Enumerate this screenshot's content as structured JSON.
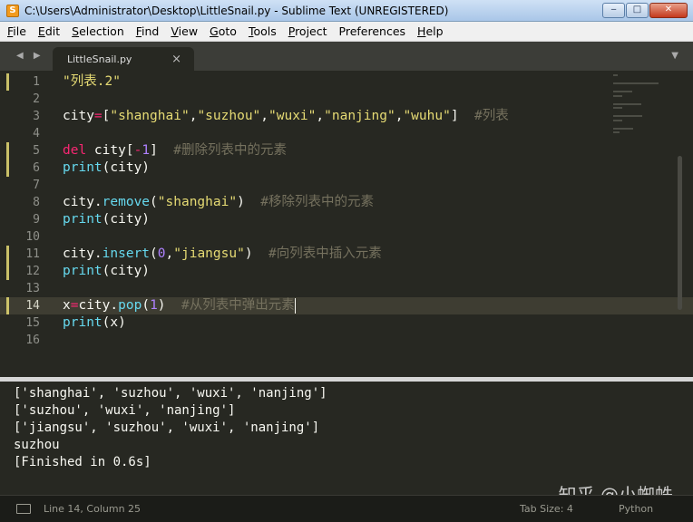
{
  "window": {
    "title": "C:\\Users\\Administrator\\Desktop\\LittleSnail.py - Sublime Text (UNREGISTERED)",
    "app_icon": "S",
    "minimize": "‒",
    "maximize": "□",
    "close": "✕"
  },
  "menu": {
    "items": [
      {
        "first": "F",
        "rest": "ile"
      },
      {
        "first": "E",
        "rest": "dit"
      },
      {
        "first": "S",
        "rest": "election"
      },
      {
        "first": "F",
        "rest": "ind"
      },
      {
        "first": "V",
        "rest": "iew"
      },
      {
        "first": "G",
        "rest": "oto"
      },
      {
        "first": "T",
        "rest": "ools"
      },
      {
        "first": "P",
        "rest": "roject"
      },
      {
        "first": "",
        "rest": "Preferences"
      },
      {
        "first": "H",
        "rest": "elp"
      }
    ]
  },
  "tabs": {
    "nav": "◀ ▶",
    "active": {
      "label": "LittleSnail.py",
      "close": "×"
    },
    "dropdown": "▼"
  },
  "editor": {
    "active_line": 14,
    "lines": [
      {
        "num": "1",
        "tokens": [
          {
            "t": "\"列表.2\"",
            "c": "s"
          }
        ]
      },
      {
        "num": "2",
        "tokens": []
      },
      {
        "num": "3",
        "tokens": [
          {
            "t": "city",
            "c": ""
          },
          {
            "t": "=",
            "c": "k"
          },
          {
            "t": "[",
            "c": ""
          },
          {
            "t": "\"shanghai\"",
            "c": "s"
          },
          {
            "t": ",",
            "c": ""
          },
          {
            "t": "\"suzhou\"",
            "c": "s"
          },
          {
            "t": ",",
            "c": ""
          },
          {
            "t": "\"wuxi\"",
            "c": "s"
          },
          {
            "t": ",",
            "c": ""
          },
          {
            "t": "\"nanjing\"",
            "c": "s"
          },
          {
            "t": ",",
            "c": ""
          },
          {
            "t": "\"wuhu\"",
            "c": "s"
          },
          {
            "t": "]  ",
            "c": ""
          },
          {
            "t": "#列表",
            "c": "c"
          }
        ]
      },
      {
        "num": "4",
        "tokens": []
      },
      {
        "num": "5",
        "tokens": [
          {
            "t": "del",
            "c": "k"
          },
          {
            "t": " city[",
            "c": ""
          },
          {
            "t": "-",
            "c": "k"
          },
          {
            "t": "1",
            "c": "n"
          },
          {
            "t": "]  ",
            "c": ""
          },
          {
            "t": "#删除列表中的元素",
            "c": "c"
          }
        ]
      },
      {
        "num": "6",
        "tokens": [
          {
            "t": "print",
            "c": "f"
          },
          {
            "t": "(city)",
            "c": ""
          }
        ]
      },
      {
        "num": "7",
        "tokens": []
      },
      {
        "num": "8",
        "tokens": [
          {
            "t": "city.",
            "c": ""
          },
          {
            "t": "remove",
            "c": "f"
          },
          {
            "t": "(",
            "c": ""
          },
          {
            "t": "\"shanghai\"",
            "c": "s"
          },
          {
            "t": ")  ",
            "c": ""
          },
          {
            "t": "#移除列表中的元素",
            "c": "c"
          }
        ]
      },
      {
        "num": "9",
        "tokens": [
          {
            "t": "print",
            "c": "f"
          },
          {
            "t": "(city)",
            "c": ""
          }
        ]
      },
      {
        "num": "10",
        "tokens": []
      },
      {
        "num": "11",
        "tokens": [
          {
            "t": "city.",
            "c": ""
          },
          {
            "t": "insert",
            "c": "f"
          },
          {
            "t": "(",
            "c": ""
          },
          {
            "t": "0",
            "c": "n"
          },
          {
            "t": ",",
            "c": ""
          },
          {
            "t": "\"jiangsu\"",
            "c": "s"
          },
          {
            "t": ")  ",
            "c": ""
          },
          {
            "t": "#向列表中插入元素",
            "c": "c"
          }
        ]
      },
      {
        "num": "12",
        "tokens": [
          {
            "t": "print",
            "c": "f"
          },
          {
            "t": "(city)",
            "c": ""
          }
        ]
      },
      {
        "num": "13",
        "tokens": []
      },
      {
        "num": "14",
        "tokens": [
          {
            "t": "x",
            "c": ""
          },
          {
            "t": "=",
            "c": "k"
          },
          {
            "t": "city.",
            "c": ""
          },
          {
            "t": "pop",
            "c": "f"
          },
          {
            "t": "(",
            "c": ""
          },
          {
            "t": "1",
            "c": "n"
          },
          {
            "t": ")  ",
            "c": ""
          },
          {
            "t": "#从列表中弹出元素",
            "c": "c"
          }
        ],
        "cursor": true
      },
      {
        "num": "15",
        "tokens": [
          {
            "t": "print",
            "c": "f"
          },
          {
            "t": "(x)",
            "c": ""
          }
        ]
      },
      {
        "num": "16",
        "tokens": []
      }
    ],
    "modified_lines": [
      "1",
      "5",
      "6",
      "11",
      "12",
      "14"
    ]
  },
  "output": {
    "lines": [
      "['shanghai', 'suzhou', 'wuxi', 'nanjing']",
      "['suzhou', 'wuxi', 'nanjing']",
      "['jiangsu', 'suzhou', 'wuxi', 'nanjing']",
      "suzhou",
      "[Finished in 0.6s]"
    ]
  },
  "watermark": "知乎 @小蜘蛛",
  "status": {
    "position": "Line 14, Column 25",
    "tab_size": "Tab Size: 4",
    "syntax": "Python"
  }
}
